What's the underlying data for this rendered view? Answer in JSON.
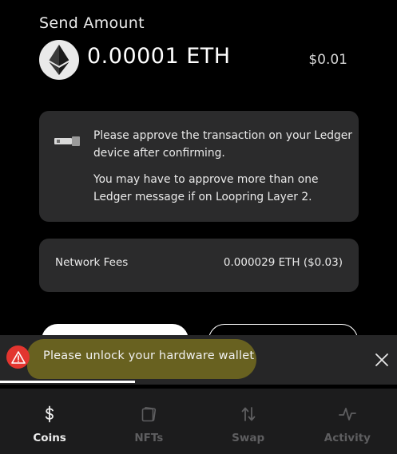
{
  "header": {
    "title": "Send Amount",
    "amount": "0.00001 ETH",
    "fiat": "$0.01",
    "token_icon": "ethereum-icon"
  },
  "ledger_notice": {
    "icon": "usb-stick-icon",
    "line1": "Please approve the transaction on your Ledger device after confirming.",
    "line2": "You may have to approve more than one Ledger message if on Loopring Layer 2."
  },
  "fees": {
    "label": "Network Fees",
    "value": "0.000029 ETH ($0.03)"
  },
  "toast": {
    "message": "Please unlock your hardware wallet",
    "icon": "warning-icon",
    "progress": 0.34,
    "status_color": "#e3352f",
    "highlight_color": "#6b6420"
  },
  "nav": {
    "items": [
      {
        "label": "Coins",
        "icon": "dollar-icon",
        "active": true
      },
      {
        "label": "NFTs",
        "icon": "nft-cards-icon",
        "active": false
      },
      {
        "label": "Swap",
        "icon": "swap-arrows-icon",
        "active": false
      },
      {
        "label": "Activity",
        "icon": "activity-pulse-icon",
        "active": false
      }
    ]
  }
}
